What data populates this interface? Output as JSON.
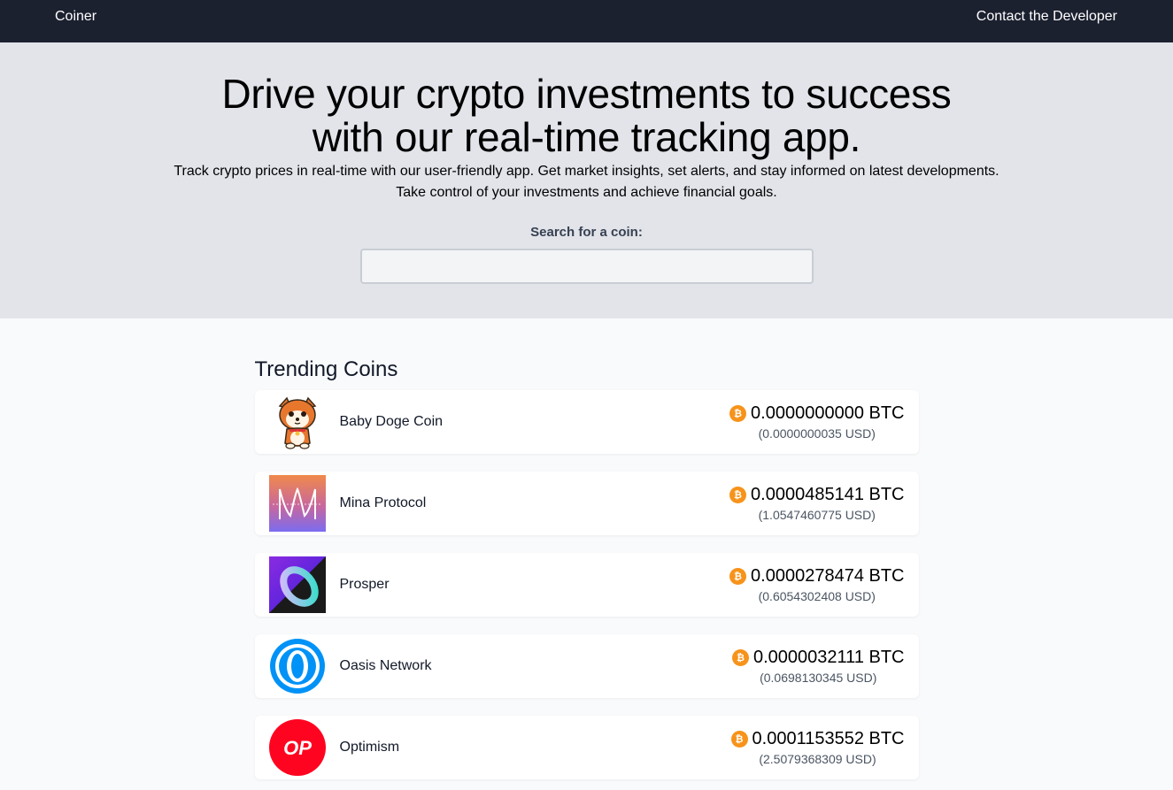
{
  "nav": {
    "brand": "Coiner",
    "contact": "Contact the Developer"
  },
  "hero": {
    "title_line1": "Drive your crypto investments to success",
    "title_line2": "with our real-time tracking app.",
    "subtitle_line1": "Track crypto prices in real-time with our user-friendly app. Get market insights, set alerts, and stay informed on latest developments.",
    "subtitle_line2": "Take control of your investments and achieve financial goals.",
    "search_label": "Search for a coin:",
    "search_value": ""
  },
  "trending": {
    "title": "Trending Coins",
    "btc_icon": "bitcoin-icon",
    "coins": [
      {
        "name": "Baby Doge Coin",
        "btc": "0.0000000000 BTC",
        "usd": "(0.0000000035 USD)",
        "icon": "baby-doge-coin-logo"
      },
      {
        "name": "Mina Protocol",
        "btc": "0.0000485141 BTC",
        "usd": "(1.0547460775 USD)",
        "icon": "mina-protocol-logo"
      },
      {
        "name": "Prosper",
        "btc": "0.0000278474 BTC",
        "usd": "(0.6054302408 USD)",
        "icon": "prosper-logo"
      },
      {
        "name": "Oasis Network",
        "btc": "0.0000032111 BTC",
        "usd": "(0.0698130345 USD)",
        "icon": "oasis-network-logo"
      },
      {
        "name": "Optimism",
        "btc": "0.0001153552 BTC",
        "usd": "(2.5079368309 USD)",
        "icon": "optimism-logo",
        "logo_text": "OP"
      }
    ]
  },
  "colors": {
    "nav_bg": "#1c2130",
    "hero_bg": "#e2e4ea",
    "page_bg": "#f8fafc",
    "bitcoin": "#f7931a",
    "optimism_red": "#ff0420",
    "oasis_blue": "#0092f6"
  }
}
